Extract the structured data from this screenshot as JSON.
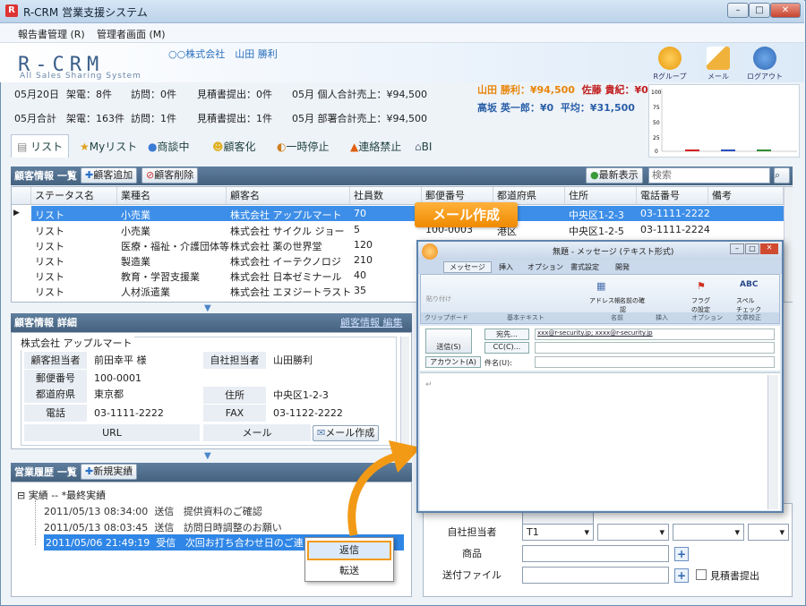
{
  "window": {
    "app_icon": "R",
    "title": "R-CRM 営業支援システム",
    "minimize": "–",
    "maximize": "□",
    "close": "✕"
  },
  "menu": {
    "reports": "報告書管理 (R)",
    "admin": "管理者画面 (M)"
  },
  "header": {
    "logo": "R-CRM",
    "logo_sub": "All Sales Sharing System",
    "company_user": "○○株式会社　山田 勝利",
    "icons": {
      "group": "Rグループ",
      "mail": "メール",
      "logout": "ログアウト"
    }
  },
  "stats": {
    "row1": {
      "date": "05月20日",
      "calls": "架電：8件",
      "visits": "訪問：0件",
      "quotes": "見積書提出：0件",
      "personal_sales": "05月 個人合計売上：¥94,500"
    },
    "row2": {
      "period": "05月合計",
      "calls": "架電：163件",
      "visits": "訪問：1件",
      "quotes": "見積書提出：1件",
      "dept_sales": "05月 部署合計売上：¥94,500"
    }
  },
  "sales_ranking": {
    "a": "山田 勝利：¥94,500",
    "b": "佐藤 貴紀：¥0",
    "c": "高坂 英一郎：¥0",
    "d": "平均：¥31,500"
  },
  "mini_chart": {
    "yticks": [
      "100",
      "75",
      "50",
      "25",
      "0"
    ],
    "colors": [
      "#d62020",
      "#2a4fbf",
      "#2f8f2f"
    ]
  },
  "tabs": [
    "リスト",
    "Myリスト",
    "商談中",
    "顧客化",
    "一時停止",
    "連絡禁止",
    "BI"
  ],
  "customers": {
    "title": "顧客情報 一覧",
    "add": "顧客追加",
    "delete": "顧客削除",
    "latest": "最新表示",
    "search_placeholder": "検索",
    "columns": [
      "ステータス名",
      "業種名",
      "顧客名",
      "社員数",
      "郵便番号",
      "都道府県",
      "住所",
      "電話番号",
      "備考"
    ],
    "rows": [
      [
        "リスト",
        "小売業",
        "株式会社 アップルマート",
        "70",
        "",
        "",
        "中央区1-2-3",
        "03-1111-2222",
        ""
      ],
      [
        "リスト",
        "小売業",
        "株式会社 サイクル ジョー",
        "5",
        "100-0003",
        "港区",
        "中央区1-2-5",
        "03-1111-2224",
        ""
      ],
      [
        "リスト",
        "医療・福祉・介護団体等",
        "株式会社 薬の世界堂",
        "120",
        "",
        "",
        "",
        "",
        ""
      ],
      [
        "リスト",
        "製造業",
        "株式会社 イーテクノロジ",
        "210",
        "",
        "",
        "",
        "",
        ""
      ],
      [
        "リスト",
        "教育・学習支援業",
        "株式会社 日本ゼミナール",
        "40",
        "",
        "",
        "",
        "",
        ""
      ],
      [
        "リスト",
        "人材派遣業",
        "株式会社 エヌジートラスト",
        "35",
        "",
        "",
        "",
        "",
        ""
      ]
    ]
  },
  "detail": {
    "title": "顧客情報 詳細",
    "link": "顧客情報 編集",
    "company": "株式会社 アップルマート",
    "person_label": "顧客担当者",
    "person": "前田幸平 様",
    "owner_label": "自社担当者",
    "owner": "山田勝利",
    "zip_label": "郵便番号",
    "zip": "100-0001",
    "pref_label": "都道府県",
    "pref": "東京都",
    "addr_label": "住所",
    "addr": "中央区1-2-3",
    "tel_label": "電話",
    "tel": "03-1111-2222",
    "fax_label": "FAX",
    "fax": "03-1122-2222",
    "url_label": "URL",
    "mail_label": "メール",
    "mail_button": "メール作成"
  },
  "history": {
    "title": "営業履歴 一覧",
    "new": "新規実績",
    "root": "実績 -- *最終実績",
    "rows": [
      {
        "date": "2011/05/13 08:34:00",
        "type": "送信",
        "subject": "提供資料のご確認"
      },
      {
        "date": "2011/05/13 08:03:45",
        "type": "送信",
        "subject": "訪問日時調整のお願い"
      },
      {
        "date": "2011/05/06 21:49:19",
        "type": "受信",
        "subject": "次回お打ち合わせ日のご連"
      }
    ]
  },
  "context_menu": {
    "reply": "返信",
    "forward": "転送"
  },
  "callout": "メール作成",
  "outlook": {
    "title": "無題 - メッセージ (テキスト形式)",
    "tabs": [
      "メッセージ",
      "挿入",
      "オプション",
      "書式設定",
      "開発"
    ],
    "groups": [
      "クリップボード",
      "基本テキスト",
      "名前",
      "挿入",
      "オプション",
      "文章校正"
    ],
    "ribbon_labels": {
      "paste": "貼り付け",
      "address_book": "アドレス帳",
      "check_names": "名前の確認",
      "flag": "フラグの設定",
      "spell": "スペル チェック"
    },
    "send": "送信(S)",
    "to_button": "宛先...",
    "cc_button": "CC(C)...",
    "account": "アカウント(A)",
    "subject_label": "件名(U):",
    "to_value": "xxx@r-security.jp; xxxx@r-security.jp"
  },
  "right_form": {
    "owner_label": "自社担当者",
    "owner_value": "T1",
    "product_label": "商品",
    "attach_label": "送付ファイル",
    "quote_label": "見積書提出"
  }
}
